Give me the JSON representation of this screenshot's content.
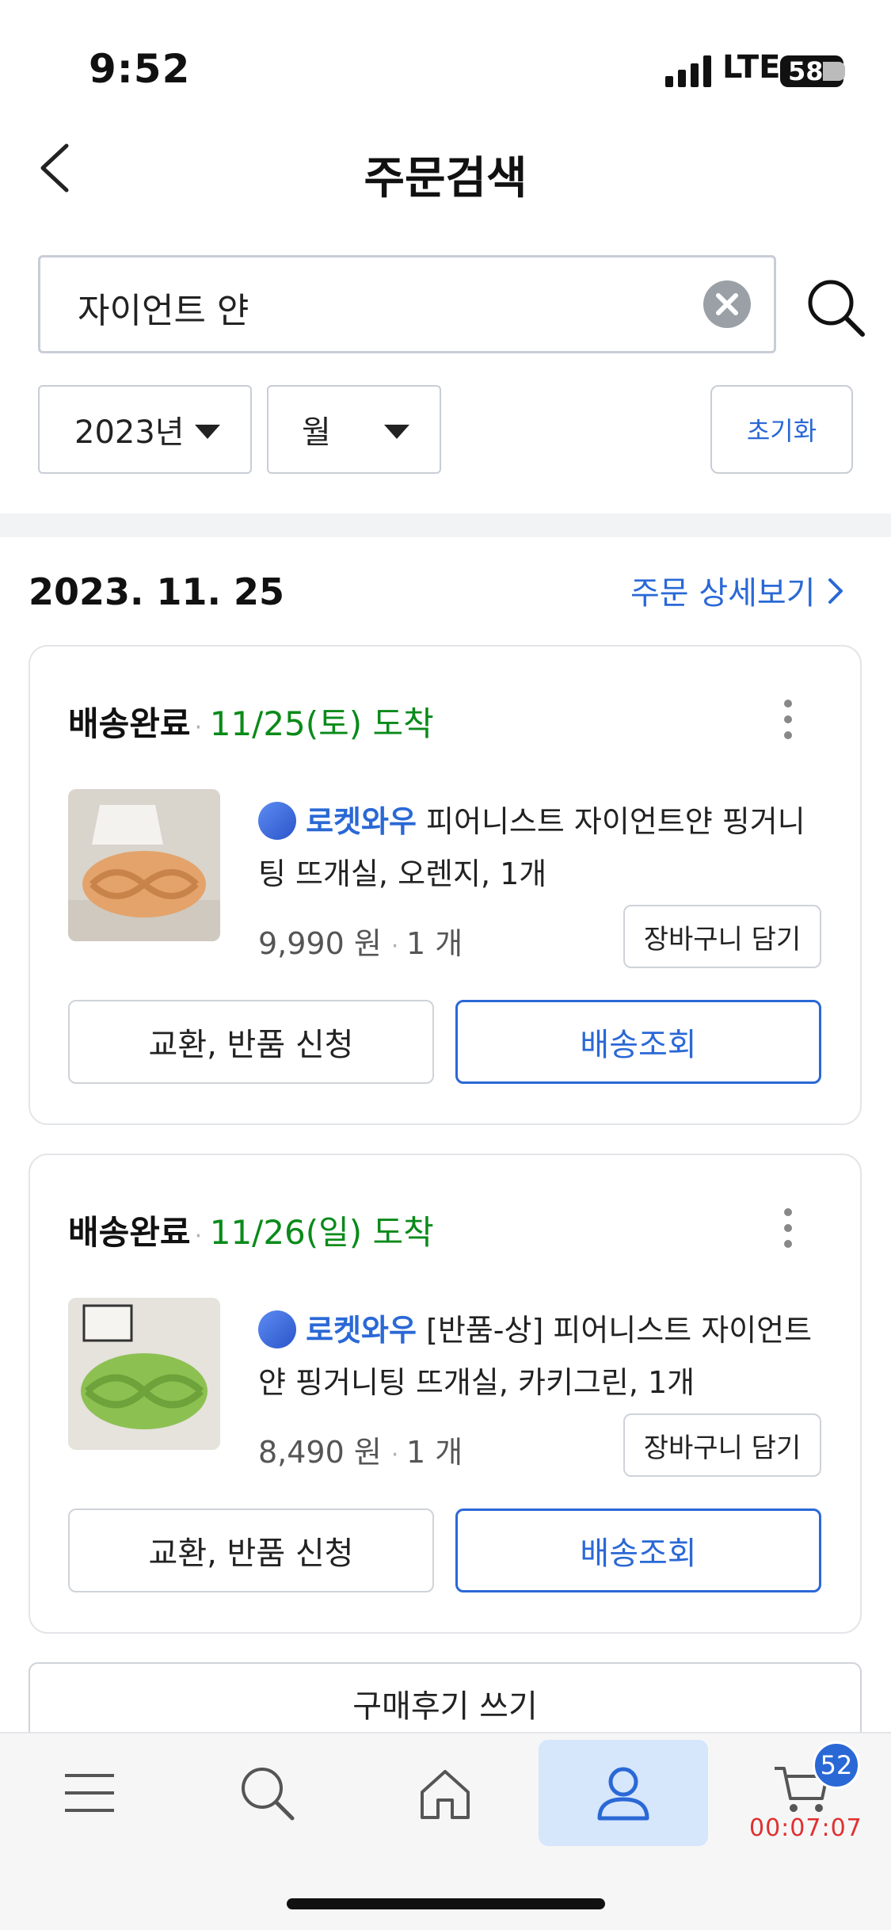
{
  "status_bar": {
    "time": "9:52",
    "network": "LTE",
    "battery": "58"
  },
  "header": {
    "title": "주문검색"
  },
  "search": {
    "query": "자이언트 얀"
  },
  "filters": {
    "year": "2023년",
    "month": "월",
    "reset_label": "초기화"
  },
  "order": {
    "date": "2023. 11. 25",
    "detail_link": "주문 상세보기"
  },
  "cards": [
    {
      "status": "배송완료",
      "arrival": "11/25(토) 도착",
      "badge": "로켓와우",
      "name_line1": "피어니스트 자이언트얀 핑거니",
      "name_line2": "팅 뜨개실, 오렌지, 1개",
      "price": "9,990 원",
      "qty": "1 개",
      "cart_label": "장바구니 담기",
      "exchange_label": "교환, 반품 신청",
      "track_label": "배송조회",
      "thumb_color": "#e3a36a"
    },
    {
      "status": "배송완료",
      "arrival": "11/26(일) 도착",
      "badge": "로켓와우",
      "name_line1": "[반품-상] 피어니스트 자이언트",
      "name_line2": "얀 핑거니팅 뜨개실, 카키그린, 1개",
      "price": "8,490 원",
      "qty": "1 개",
      "cart_label": "장바구니 담기",
      "exchange_label": "교환, 반품 신청",
      "track_label": "배송조회",
      "thumb_color": "#8cc152"
    }
  ],
  "review": {
    "label": "구매후기 쓰기"
  },
  "bottom_nav": {
    "items": [
      "menu-icon",
      "search-icon",
      "home-icon",
      "user-icon",
      "cart-icon"
    ],
    "cart_badge": "52",
    "timer": "00:07:07"
  },
  "colors": {
    "accent": "#2a68d6",
    "green": "#0a8a1a",
    "timer": "#e03030"
  }
}
